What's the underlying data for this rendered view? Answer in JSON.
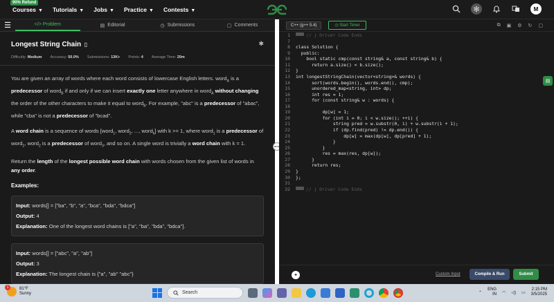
{
  "topnav": {
    "refund_badge": "90% Refund",
    "menu": [
      "Courses",
      "Tutorials",
      "Jobs",
      "Practice",
      "Contests"
    ],
    "avatar_letter": "M"
  },
  "tabs": [
    {
      "label": "</> Problem",
      "icon": "code-icon"
    },
    {
      "label": "Editorial",
      "icon": "document-icon"
    },
    {
      "label": "Submissions",
      "icon": "clock-icon"
    },
    {
      "label": "Comments",
      "icon": "comment-icon"
    }
  ],
  "problem": {
    "title": "Longest String Chain",
    "meta": [
      {
        "label": "Difficulty:",
        "value": "Medium"
      },
      {
        "label": "Accuracy:",
        "value": "50.0%"
      },
      {
        "label": "Submissions:",
        "value": "13K+"
      },
      {
        "label": "Points:",
        "value": "4"
      },
      {
        "label": "Average Time:",
        "value": "20m"
      }
    ],
    "p1": {
      "a": "You are given an array of words where each word consists of lowercase English letters. word",
      "a_sub": "A",
      "b": " is a ",
      "b_bold": "predecessor",
      "c": " of word",
      "c_sub": "B",
      "d": " if and only if we can insert ",
      "d_bold": "exactly one",
      "e": " letter anywhere in word",
      "e_sub": "A",
      "f_bold": " without changing",
      "g": " the order of the other characters to make it equal to word",
      "g_sub": "B",
      "h": ". For example, \"abc\" is a ",
      "h_bold": "predecessor",
      "i": " of \"abac\", while \"cba\" is not a ",
      "i_bold": "predecessor",
      "j": " of \"bcad\"."
    },
    "p2": {
      "a": "A ",
      "a_bold": "word chain",
      "b": " is a sequence of words [word",
      "b_sub": "1",
      "c": ", word",
      "c_sub": "2",
      "d": ", ..., word",
      "d_sub": "k",
      "e": "] with k >= 1, where word",
      "e_sub": "1",
      "f": " is a ",
      "f_bold": "predecessor",
      "g": " of word",
      "g_sub": "2",
      "h": ", word",
      "h_sub": "2",
      "i": " is a ",
      "i_bold": "predecessor",
      "j": " of word",
      "j_sub": "3",
      "k": ", and so on. A single word is trivially a ",
      "k_bold": "word chain",
      "l": " with k = 1."
    },
    "p3": {
      "a": "Return the ",
      "a_bold": "length",
      "b": " of the ",
      "b_bold": "longest possible word chain",
      "c": " with words chosen from the given list of words in ",
      "c_bold": "any order",
      "d": "."
    },
    "examples_heading": "Examples:",
    "examples": [
      {
        "input_label": "Input:",
        "input": " words[] = [\"ba\", \"b\", \"a\", \"bca\", \"bda\", \"bdca\"]",
        "output_label": "Output:",
        "output": " 4",
        "expl_label": "Explanation:",
        "expl": " One of the longest word chains is [\"a\", \"ba\", \"bda\", \"bdca\"]."
      },
      {
        "input_label": "Input:",
        "input": " words[] = [\"abc\", \"a\", \"ab\"]",
        "output_label": "Output:",
        "output": " 3",
        "expl_label": "Explanation:",
        "expl": " The longest chain is {\"a\", \"ab\" \"abc\"}"
      }
    ]
  },
  "editor": {
    "language": "C++ (g++ 5.4)",
    "timer_label": "Start Timer",
    "lines": [
      {
        "n": "1",
        "t": "// } Driver Code Ends",
        "fold": true,
        "dim": true
      },
      {
        "n": "7",
        "t": ""
      },
      {
        "n": "8",
        "t": "class Solution {"
      },
      {
        "n": "9",
        "t": "  public:"
      },
      {
        "n": "10",
        "t": "    bool static cmp(const string& a, const string& b) {"
      },
      {
        "n": "11",
        "t": "      return a.size() < b.size();"
      },
      {
        "n": "12",
        "t": "}"
      },
      {
        "n": "13",
        "t": "int longestStringChain(vector<string>& words) {"
      },
      {
        "n": "14",
        "t": "      sort(words.begin(), words.end(), cmp);"
      },
      {
        "n": "15",
        "t": "      unordered_map<string, int> dp;"
      },
      {
        "n": "16",
        "t": "      int res = 1;"
      },
      {
        "n": "17",
        "t": "      for (const string& w : words) {"
      },
      {
        "n": "18",
        "t": ""
      },
      {
        "n": "19",
        "t": "          dp[w] = 1;"
      },
      {
        "n": "20",
        "t": "          for (int i = 0; i < w.size(); ++i) {"
      },
      {
        "n": "21",
        "t": "              string pred = w.substr(0, i) + w.substr(i + 1);"
      },
      {
        "n": "22",
        "t": "              if (dp.find(pred) != dp.end()) {"
      },
      {
        "n": "23",
        "t": "                  dp[w] = max(dp[w], dp[pred] + 1);"
      },
      {
        "n": "24",
        "t": "              }"
      },
      {
        "n": "25",
        "t": "          }"
      },
      {
        "n": "26",
        "t": "          res = max(res, dp[w]);"
      },
      {
        "n": "27",
        "t": "      }"
      },
      {
        "n": "28",
        "t": "      return res;"
      },
      {
        "n": "29",
        "t": "}"
      },
      {
        "n": "30",
        "t": "};"
      },
      {
        "n": "31",
        "t": ""
      },
      {
        "n": "32",
        "t": "// } Driver Code Ends",
        "fold": true,
        "dim": true
      }
    ],
    "custom_input": "Custom Input",
    "compile_label": "Compile & Run",
    "submit_label": "Submit"
  },
  "taskbar": {
    "temp": "81°F",
    "weather": "Sunny",
    "weather_badge": "1",
    "search": "Search",
    "lang1": "ENG",
    "lang2": "IN",
    "time": "2:15 PM",
    "date": "3/5/2025"
  },
  "colors": {
    "accent_green": "#2f8d46",
    "compile_blue": "#3a4a6a"
  }
}
